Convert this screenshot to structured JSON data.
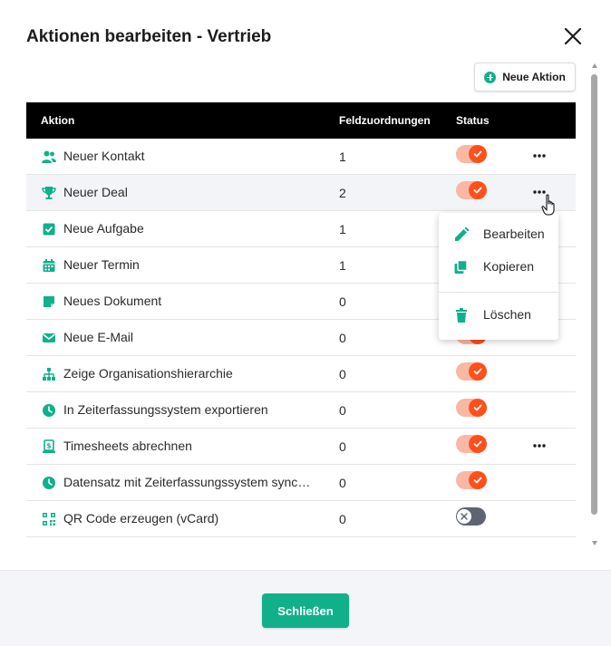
{
  "dialog": {
    "title": "Aktionen bearbeiten - Vertrieb",
    "new_action_label": "Neue Aktion",
    "close_button_label": "Schließen"
  },
  "table": {
    "headers": {
      "action": "Aktion",
      "field_mappings": "Feldzuordnungen",
      "status": "Status"
    },
    "rows": [
      {
        "icon": "users-icon",
        "name": "Neuer Kontakt",
        "count": "1",
        "status": "on",
        "menu": true
      },
      {
        "icon": "trophy-icon",
        "name": "Neuer Deal",
        "count": "2",
        "status": "on",
        "menu": true,
        "hover": true
      },
      {
        "icon": "task-check-icon",
        "name": "Neue Aufgabe",
        "count": "1",
        "status": "on",
        "menu": false
      },
      {
        "icon": "calendar-icon",
        "name": "Neuer Termin",
        "count": "1",
        "status": "on",
        "menu": false
      },
      {
        "icon": "document-icon",
        "name": "Neues Dokument",
        "count": "0",
        "status": "on",
        "menu": false
      },
      {
        "icon": "mail-icon",
        "name": "Neue E-Mail",
        "count": "0",
        "status": "on",
        "menu": false
      },
      {
        "icon": "hierarchy-icon",
        "name": "Zeige Organisationshierarchie",
        "count": "0",
        "status": "on",
        "menu": false
      },
      {
        "icon": "clock-icon",
        "name": "In Zeiterfassungssystem exportieren",
        "count": "0",
        "status": "on",
        "menu": false
      },
      {
        "icon": "billing-icon",
        "name": "Timesheets abrechnen",
        "count": "0",
        "status": "on",
        "menu": true
      },
      {
        "icon": "clock-icon",
        "name": "Datensatz mit Zeiterfassungssystem synchronisieren",
        "count": "0",
        "status": "on",
        "menu": false
      },
      {
        "icon": "qr-code-icon",
        "name": "QR Code erzeugen (vCard)",
        "count": "0",
        "status": "off",
        "menu": false
      }
    ]
  },
  "context_menu": {
    "edit": "Bearbeiten",
    "copy": "Kopieren",
    "delete": "Löschen"
  },
  "colors": {
    "accent": "#10b08a",
    "toggle_on": "#ff4f1b",
    "header_bg": "#000000"
  }
}
